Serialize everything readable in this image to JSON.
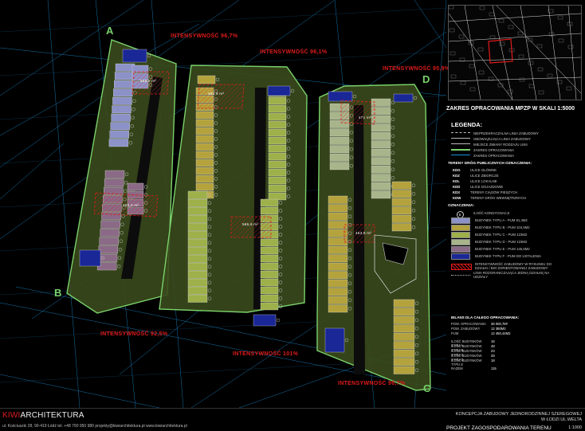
{
  "plan": {
    "intensity_labels": [
      "INTENSYWNOŚĆ 96,7%",
      "INTENSYWNOŚĆ 96,1%",
      "INTENSYWNOŚĆ 95,9%",
      "INTENSYWNOŚĆ 92,5%",
      "INTENSYWNOŚĆ 101%",
      "INTENSYWNOŚĆ 96,7%"
    ],
    "corners": [
      "A",
      "B",
      "C",
      "D"
    ],
    "area_labels": [
      "569,5 m²",
      "494,9 m²",
      "471 m²",
      "462,3 m²",
      "566,6 m²",
      "463,8 m²"
    ],
    "colors": {
      "type_a": "#8c92c8",
      "type_b": "#b4a23c",
      "type_c": "#9db04a",
      "type_d": "#a8b48a",
      "type_e": "#8a6a86",
      "type_f": "#1a2796",
      "zone_fill": "#3a4a1c",
      "zone_edge": "#7ad16b",
      "road_lines": "#1b8fd6",
      "intensity": "#e01b1b"
    }
  },
  "legend": {
    "scale_title": "ZAKRES OPRACOWANIA MPZP W SKALI 1:5000",
    "title": "LEGENDA:",
    "lines": [
      "NIEPRZEKRACZALNA LINIA ZABUDOWY",
      "OBOWIĄZUJĄCA LINIA ZABUDOWY",
      "MIEJSCE ZMIANY RODZAJU LINII",
      "ZAKRES OPRACOWANIA",
      "ZAKRES OPRACOWANIA"
    ],
    "roads_title": "TERENY DRÓG PUBLICZNYCH OZNACZENIA:",
    "roads": [
      {
        "code": "KDG",
        "label": "ULICE GŁÓWNE"
      },
      {
        "code": "KDZ",
        "label": "ULICE ZBIORCZE"
      },
      {
        "code": "KDL",
        "label": "ULICE LOKALNE"
      },
      {
        "code": "KDD",
        "label": "ULICE DOJAZDOWE"
      },
      {
        "code": "KDX",
        "label": "TERENY CIĄGÓW PIESZYCH"
      },
      {
        "code": "KDW",
        "label": "TERENY DRÓG WEWNĘTRZNYCH"
      }
    ],
    "marks_title": "OZNACZENIA:",
    "marks": [
      {
        "sym": "5",
        "label": "ILOŚĆ KONDYGNACJI"
      },
      {
        "label": "BUDYNEK TYPU A - PUM 91,4M2"
      },
      {
        "label": "BUDYNEK TYPU B - PUM 104,5M2"
      },
      {
        "label": "BUDYNEK TYPU C - PUM 123M2"
      },
      {
        "label": "BUDYNEK TYPU D - PUM 123M2"
      },
      {
        "label": "BUDYNEK TYPU E - PUM 146,6M2"
      },
      {
        "label": "BUDYNEK TYPU F - PUM DO USTALENIA"
      }
    ],
    "extra": [
      "INTENSYWNOŚĆ ZABUDOWY W RYSUNKU DO DZIAŁKI / BIO ZORIENTOWANEJ ZABUDOWY",
      "LINIA ROZGRANICZAJĄCA JEDNĄ DZIAŁKĘ NA UDZIAŁY"
    ]
  },
  "bilans": {
    "title": "BILANS DLA CAŁEGO OPRACOWANIA:",
    "rows": [
      {
        "k": "POW. OPRACOWANIA",
        "v": "36 000,7M²"
      },
      {
        "k": "POW. ZABUDOWY",
        "v": "12 380M2"
      },
      {
        "k": "PUM",
        "v": "12 450,44M2"
      },
      {
        "k": "ILOŚĆ BUDYNKÓW TYPU A",
        "v": "16"
      },
      {
        "k": "ILOŚĆ BUDYNKÓW TYPU B",
        "v": "48"
      },
      {
        "k": "ILOŚĆ BUDYNKÓW TYPU C",
        "v": "23"
      },
      {
        "k": "ILOŚĆ BUDYNKÓW TYPU D",
        "v": "28"
      },
      {
        "k": "ILOŚĆ BUDYNKÓW TYPU E",
        "v": "18"
      },
      {
        "k": "RAZEM",
        "v": "115"
      }
    ]
  },
  "footer": {
    "brand_kiwi": "KIWI",
    "brand_rest": "ARCHITEKTURA",
    "address": "ul. Kościuszki 28, 90-419 Łódź  tel. +48 790 950 980  projekty@kiwiarchitektura.pl  www.kiwiarchitektura.pl",
    "concept_line1": "KONCEPCJA ZABUDOWY JEDNORODZINNEJ SZEREGOWEJ",
    "concept_line2": "W ŁODZI UL.WELTA",
    "project_title": "PROJEKT ZAGOSPODAROWANIA TERENU",
    "scale": "1:1000"
  }
}
